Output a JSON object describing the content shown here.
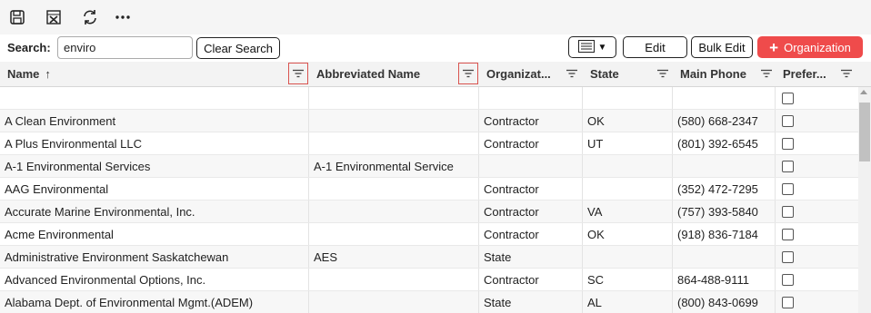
{
  "search": {
    "label": "Search:",
    "value": "enviro"
  },
  "buttons": {
    "clear_search": "Clear Search",
    "view_dropdown": "▼",
    "edit": "Edit",
    "bulk_edit": "Bulk Edit",
    "add_org_icon": "+",
    "add_org": "Organization"
  },
  "columns": [
    {
      "label": "Name",
      "sort": "↑"
    },
    {
      "label": "Abbreviated Name"
    },
    {
      "label": "Organizat..."
    },
    {
      "label": "State"
    },
    {
      "label": "Main Phone"
    },
    {
      "label": "Prefer..."
    }
  ],
  "rows": [
    {
      "name": "",
      "abbr": "",
      "org": "",
      "state": "",
      "phone": ""
    },
    {
      "name": "A Clean Environment",
      "abbr": "",
      "org": "Contractor",
      "state": "OK",
      "phone": "(580) 668-2347"
    },
    {
      "name": "A Plus Environmental LLC",
      "abbr": "",
      "org": "Contractor",
      "state": "UT",
      "phone": "(801) 392-6545"
    },
    {
      "name": "A-1 Environmental Services",
      "abbr": "A-1 Environmental Service",
      "org": "",
      "state": "",
      "phone": ""
    },
    {
      "name": "AAG Environmental",
      "abbr": "",
      "org": "Contractor",
      "state": "",
      "phone": "(352) 472-7295"
    },
    {
      "name": "Accurate Marine Environmental, Inc.",
      "abbr": "",
      "org": "Contractor",
      "state": "VA",
      "phone": "(757) 393-5840"
    },
    {
      "name": "Acme Environmental",
      "abbr": "",
      "org": "Contractor",
      "state": "OK",
      "phone": "(918) 836-7184"
    },
    {
      "name": "Administrative Environment Saskatchewan",
      "abbr": "AES",
      "org": "State",
      "state": "",
      "phone": ""
    },
    {
      "name": "Advanced Environmental Options, Inc.",
      "abbr": "",
      "org": "Contractor",
      "state": "SC",
      "phone": "864-488-9111"
    },
    {
      "name": "Alabama Dept. of Environmental Mgmt.(ADEM)",
      "abbr": "",
      "org": "State",
      "state": "AL",
      "phone": "(800) 843-0699"
    }
  ],
  "colors": {
    "accent": "#ef4b4b",
    "header_bg": "#f3f3f3",
    "alt_row": "#f7f7f7"
  },
  "icons": [
    "save-icon",
    "excel-export-icon",
    "refresh-icon",
    "more-icon",
    "column-chooser-icon",
    "filter-icon"
  ]
}
